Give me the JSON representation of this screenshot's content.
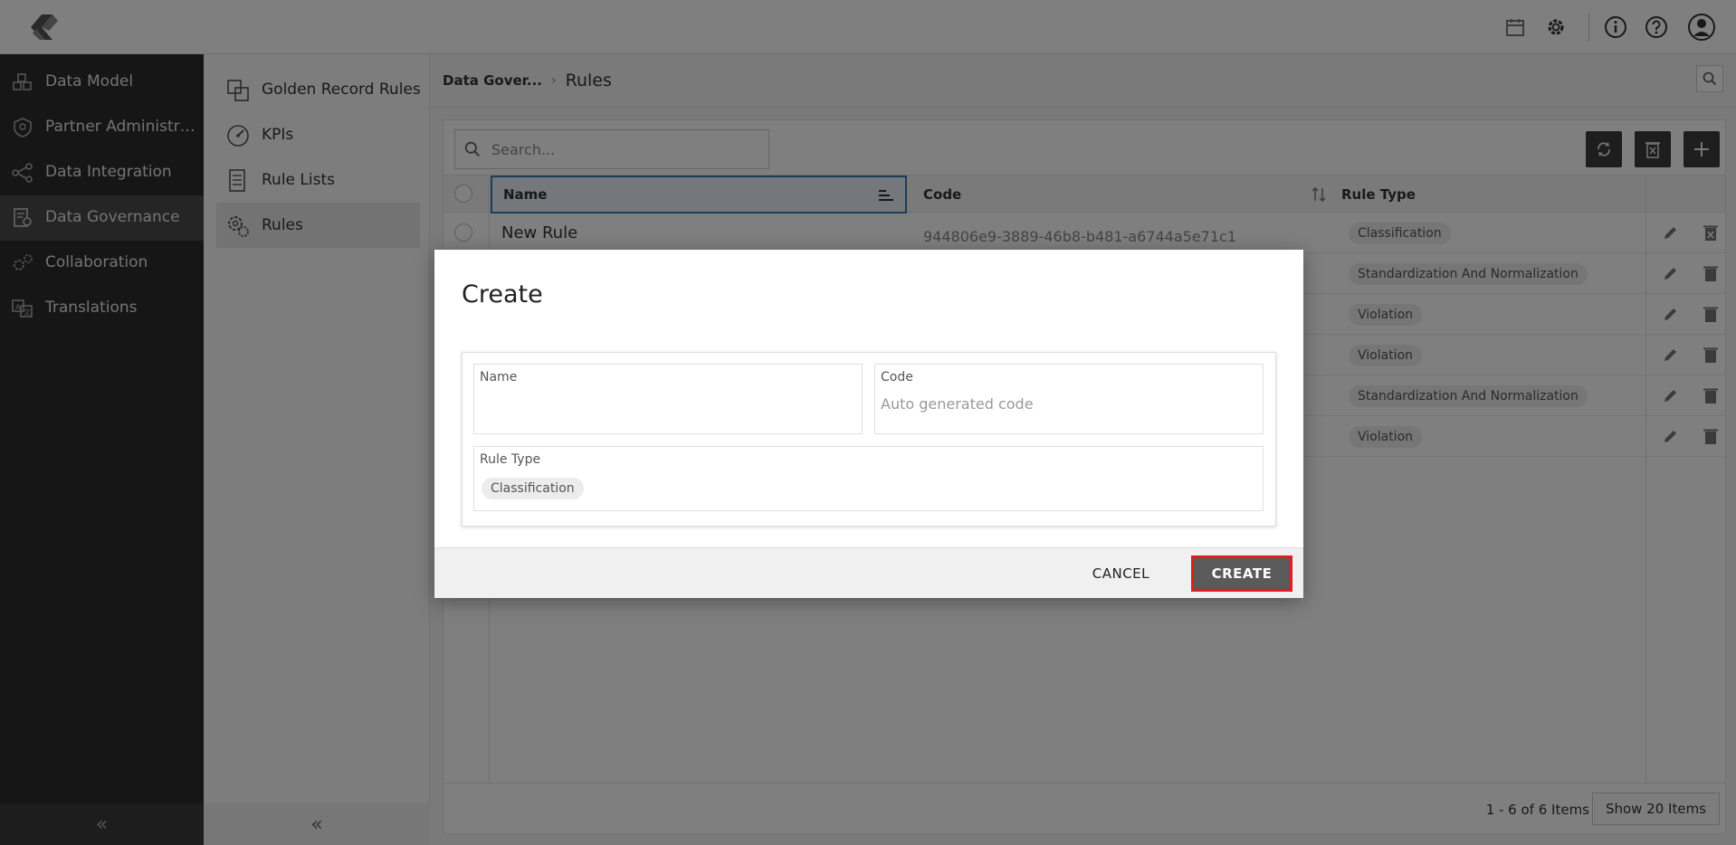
{
  "nav": {
    "items": [
      {
        "label": "Data Model",
        "icon": "cubes-icon"
      },
      {
        "label": "Partner Administrati...",
        "icon": "shield-icon"
      },
      {
        "label": "Data Integration",
        "icon": "share-icon"
      },
      {
        "label": "Data Governance",
        "icon": "governance-icon",
        "active": true
      },
      {
        "label": "Collaboration",
        "icon": "gears-icon"
      },
      {
        "label": "Translations",
        "icon": "translate-icon"
      }
    ],
    "collapse_glyph": "«"
  },
  "subnav": {
    "items": [
      {
        "label": "Golden Record Rules",
        "icon": "golden-record-icon"
      },
      {
        "label": "KPIs",
        "icon": "gauge-icon"
      },
      {
        "label": "Rule Lists",
        "icon": "list-icon"
      },
      {
        "label": "Rules",
        "icon": "rules-gear-icon",
        "active": true
      }
    ],
    "collapse_glyph": "«"
  },
  "breadcrumb": {
    "parent": "Data Gover...",
    "separator": "›",
    "current": "Rules"
  },
  "search": {
    "placeholder": "Search..."
  },
  "table": {
    "columns": [
      "Name",
      "Code",
      "Rule Type"
    ],
    "rows": [
      {
        "name": "New Rule",
        "code": "944806e9-3889-46b8-b481-a6744a5e71c1",
        "type": "Classification"
      },
      {
        "name": "",
        "code": "",
        "type": "Standardization And Normalization"
      },
      {
        "name": "",
        "code": "",
        "type": "Violation"
      },
      {
        "name": "",
        "code": "",
        "type": "Violation"
      },
      {
        "name": "",
        "code": "",
        "type": "Standardization And Normalization"
      },
      {
        "name": "",
        "code": "",
        "type": "Violation"
      }
    ],
    "pager": "1 - 6 of 6 Items",
    "show_label": "Show 20 Items"
  },
  "dialog": {
    "title": "Create",
    "name_label": "Name",
    "name_value": "",
    "code_label": "Code",
    "code_placeholder": "Auto generated code",
    "rule_type_label": "Rule Type",
    "rule_type_value": "Classification",
    "cancel_label": "CANCEL",
    "create_label": "CREATE"
  },
  "colors": {
    "accent": "#3a78b8",
    "highlight": "#e31b23",
    "nav_bg": "#2d2d2d"
  }
}
